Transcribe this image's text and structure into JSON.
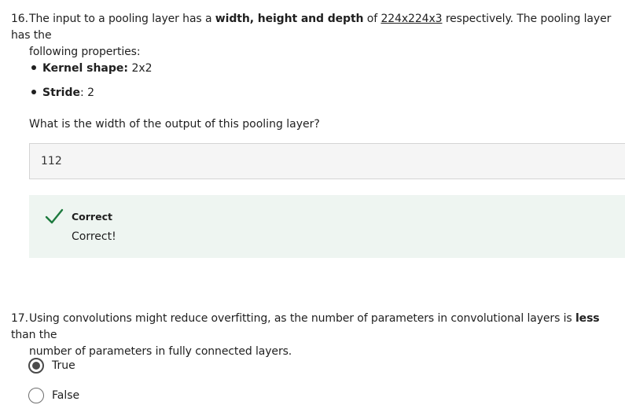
{
  "q16": {
    "number": "16.",
    "intro": "The input to a pooling layer has a ",
    "dims_bold": "width, height and depth",
    "of": " of ",
    "dims_value": "224x224x3",
    "after": " respectively. The pooling layer has the",
    "line2": "following properties:",
    "properties": [
      {
        "label": "Kernel shape:",
        "value": " 2x2"
      },
      {
        "label": "Stride",
        "value": ": 2"
      }
    ],
    "prompt": "What is the width of the output of this pooling layer?",
    "answer": "112",
    "feedback": {
      "status": "Correct",
      "message": "Correct!",
      "accent_color": "#1d7a3e",
      "background": "#eef5f1"
    }
  },
  "q17": {
    "number": "17.",
    "part1": "Using convolutions might reduce overfitting, as the number of parameters in convolutional layers is ",
    "bold": "less",
    "part2": " than the",
    "line2": "number of parameters in fully connected layers.",
    "options": [
      {
        "label": "True",
        "selected": true
      },
      {
        "label": "False",
        "selected": false
      }
    ]
  }
}
